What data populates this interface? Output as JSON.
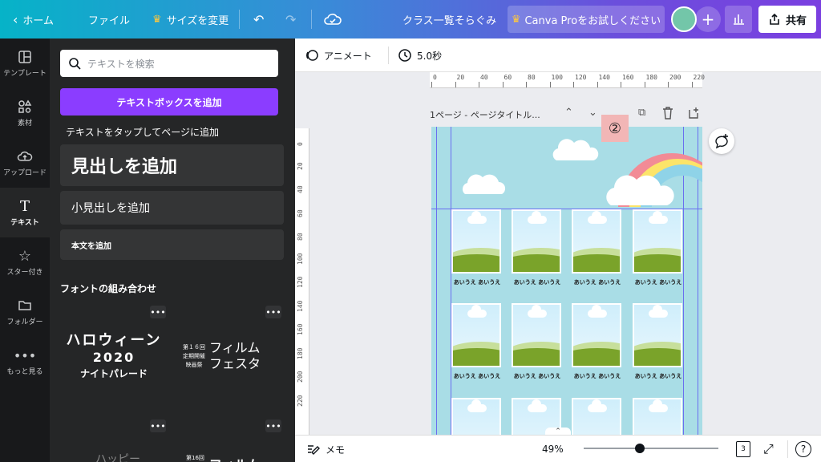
{
  "topbar": {
    "home": "ホーム",
    "file": "ファイル",
    "resize": "サイズを変更",
    "title": "クラス一覧そらぐみ",
    "pro": "Canva Proをお試しください",
    "share": "共有"
  },
  "rail": [
    {
      "label": "テンプレート",
      "icon": "template-icon"
    },
    {
      "label": "素材",
      "icon": "elements-icon"
    },
    {
      "label": "アップロード",
      "icon": "upload-icon"
    },
    {
      "label": "テキスト",
      "icon": "text-icon"
    },
    {
      "label": "スター付き",
      "icon": "star-icon"
    },
    {
      "label": "フォルダー",
      "icon": "folder-icon"
    },
    {
      "label": "もっと見る",
      "icon": "more-icon"
    }
  ],
  "panel": {
    "search_placeholder": "テキストを検索",
    "add_textbox": "テキストボックスを追加",
    "tap_hint": "テキストをタップしてページに追加",
    "heading": "見出しを追加",
    "subheading": "小見出しを追加",
    "body": "本文を追加",
    "font_combos": "フォントの組み合わせ",
    "combo1_lines": [
      "ハロウィーン",
      "2020",
      "ナイトパレード"
    ],
    "combo2_small": [
      "第１６回",
      "定期開催",
      "映画祭"
    ],
    "combo2_big": [
      "フィルム",
      "フェスタ"
    ],
    "combo3_partial": "ハッピー",
    "combo4_small": "第16回",
    "combo4_partial": "フィルム"
  },
  "editor": {
    "animate": "アニメート",
    "duration": "5.0秒",
    "page_label": "1ページ - ページタイトル...",
    "badge": "②",
    "ruler_h": [
      "0",
      "20",
      "40",
      "60",
      "80",
      "100",
      "120",
      "140",
      "160",
      "180",
      "200",
      "220"
    ],
    "ruler_v": [
      "0",
      "20",
      "40",
      "60",
      "80",
      "100",
      "120",
      "140",
      "160",
      "180",
      "200",
      "220"
    ],
    "caption": "あいうえ あいうえ"
  },
  "bottom": {
    "notes": "メモ",
    "zoom": "49%",
    "zoom_level": 0.49,
    "pages": "3"
  },
  "colors": {
    "accent": "#8b3dff",
    "sky": "#a9dde6",
    "rainbow": [
      "#f28b96",
      "#fce469",
      "#8fd3e8"
    ]
  }
}
